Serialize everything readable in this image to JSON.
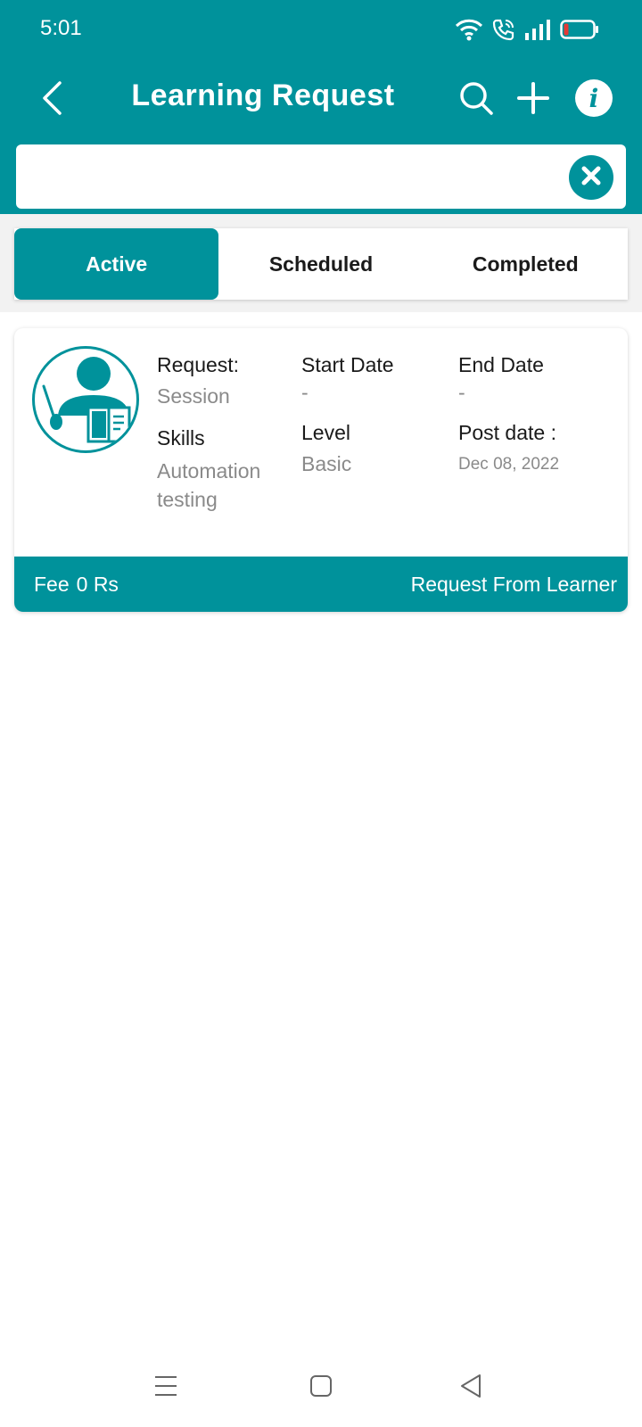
{
  "status_bar": {
    "time": "5:01",
    "icons": [
      "wifi-icon",
      "wifi-calling-icon",
      "signal-icon",
      "battery-low-icon"
    ]
  },
  "header": {
    "title": "Learning Request",
    "icons": [
      "back-arrow-icon",
      "search-icon",
      "plus-icon",
      "info-icon"
    ]
  },
  "search": {
    "value": "",
    "placeholder": "",
    "clear_icon": "close-circle-icon"
  },
  "tabs": [
    {
      "label": "Active",
      "active": true
    },
    {
      "label": "Scheduled",
      "active": false
    },
    {
      "label": "Completed",
      "active": false
    }
  ],
  "request_card": {
    "avatar_icon": "teacher-icon",
    "request_label": "Request:",
    "request_value": "Session",
    "start_date_label": "Start Date",
    "start_date_value": "-",
    "end_date_label": "End Date",
    "end_date_value": "-",
    "skills_label": "Skills",
    "skills_value_line1": "Automation",
    "skills_value_line2": "testing",
    "level_label": "Level",
    "level_value": "Basic",
    "post_date_label": "Post date :",
    "post_date_value": "Dec 08, 2022",
    "fee_label": "Fee",
    "fee_value": "0 Rs",
    "request_from": "Request From Learner"
  },
  "nav_bar": {
    "icons": [
      "menu-icon",
      "home-square-icon",
      "back-triangle-icon"
    ]
  },
  "colors": {
    "primary": "#00929b",
    "text_dark": "#1a1a1a",
    "text_muted": "#8a8a8a",
    "background": "#ffffff",
    "battery_low": "#e53935"
  }
}
